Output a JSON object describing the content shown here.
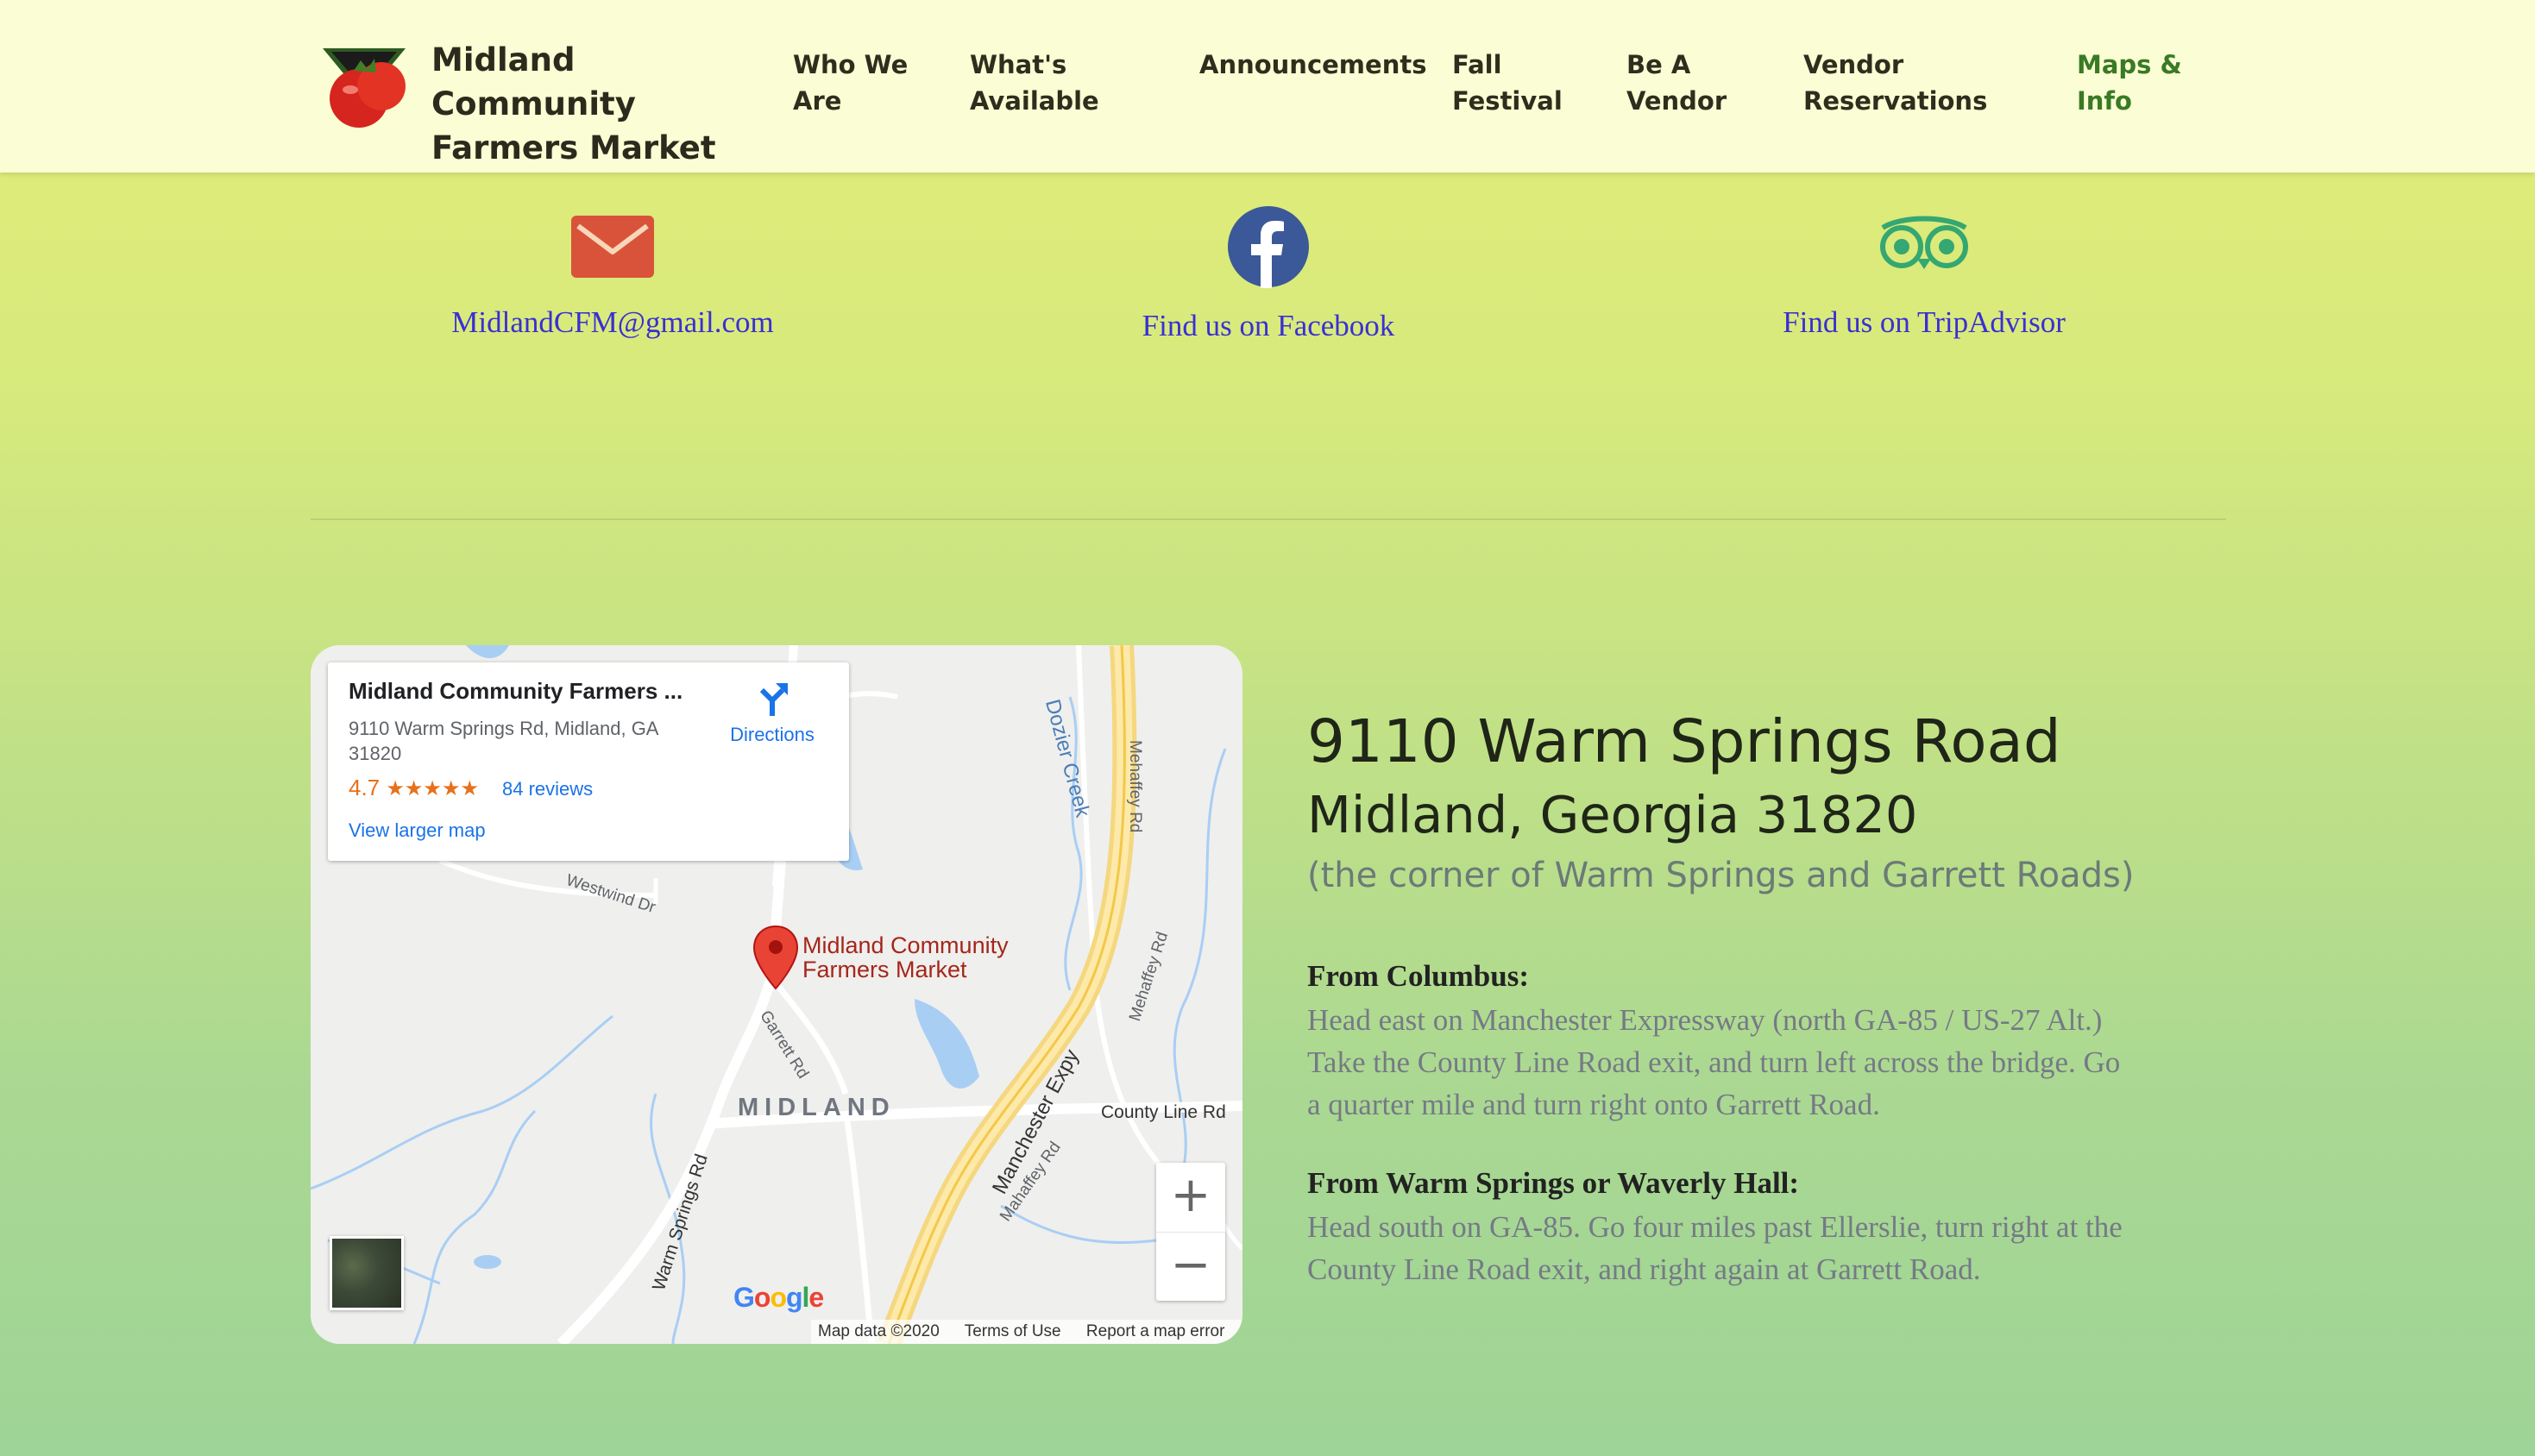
{
  "header": {
    "brand_line1": "Midland Community",
    "brand_line2": "Farmers Market",
    "nav": [
      {
        "label": "Who We\nAre"
      },
      {
        "label": "What's\nAvailable"
      },
      {
        "label": "Announcements"
      },
      {
        "label": "Fall\nFestival"
      },
      {
        "label": "Be A\nVendor"
      },
      {
        "label": "Vendor\nReservations"
      },
      {
        "label": "Maps &\nInfo",
        "active": true
      }
    ]
  },
  "contact": {
    "email": "MidlandCFM@gmail.com",
    "facebook": "Find us on Facebook",
    "tripadvisor": "Find us on TripAdvisor"
  },
  "map": {
    "card_title": "Midland Community Farmers ...",
    "card_address": "9110 Warm Springs Rd, Midland, GA 31820",
    "rating": "4.7",
    "stars": "★★★★★",
    "reviews": "84 reviews",
    "directions": "Directions",
    "view_larger": "View larger map",
    "pin_label": "Midland Community\nFarmers Market",
    "town": "MIDLAND",
    "roads": {
      "dozier_creek": "Dozier Creek",
      "mehaffey_rd_1": "Mehaffey Rd",
      "mehaffey_rd_2": "Mehaffey Rd",
      "westwind_dr": "Westwind Dr",
      "garrett_rd": "Garrett Rd",
      "manchester_expy": "Manchester Expy",
      "mahaffey_rd": "Mahaffey Rd",
      "county_line_rd": "County Line Rd",
      "warm_springs_rd": "Warm Springs Rd"
    },
    "google": "Google",
    "footer": [
      "Map data ©2020",
      "Terms of Use",
      "Report a map error"
    ]
  },
  "address": {
    "line1": "9110 Warm Springs Road",
    "line2": "Midland, Georgia 31820",
    "line3": "(the corner of Warm Springs and Garrett Roads)"
  },
  "directions": [
    {
      "heading": "From Columbus:",
      "lines": [
        "Head east on Manchester Expressway (north GA-85 / US-27 Alt.)",
        "Take the County Line Road exit, and turn left across the bridge. Go",
        "a quarter mile and turn right onto Garrett Road."
      ]
    },
    {
      "heading": "From Warm Springs or Waverly Hall:",
      "lines": [
        "Head south on GA-85. Go four miles past Ellerslie, turn right at the",
        "County Line Road exit, and right again at Garrett Road."
      ]
    }
  ],
  "colors": {
    "header_bg": "#fbfdd4",
    "link": "#3a2fd3",
    "nav_active": "#3a7a25",
    "email_icon": "#d9533b",
    "facebook_icon": "#3b5998",
    "tripadvisor_icon": "#34a772"
  }
}
